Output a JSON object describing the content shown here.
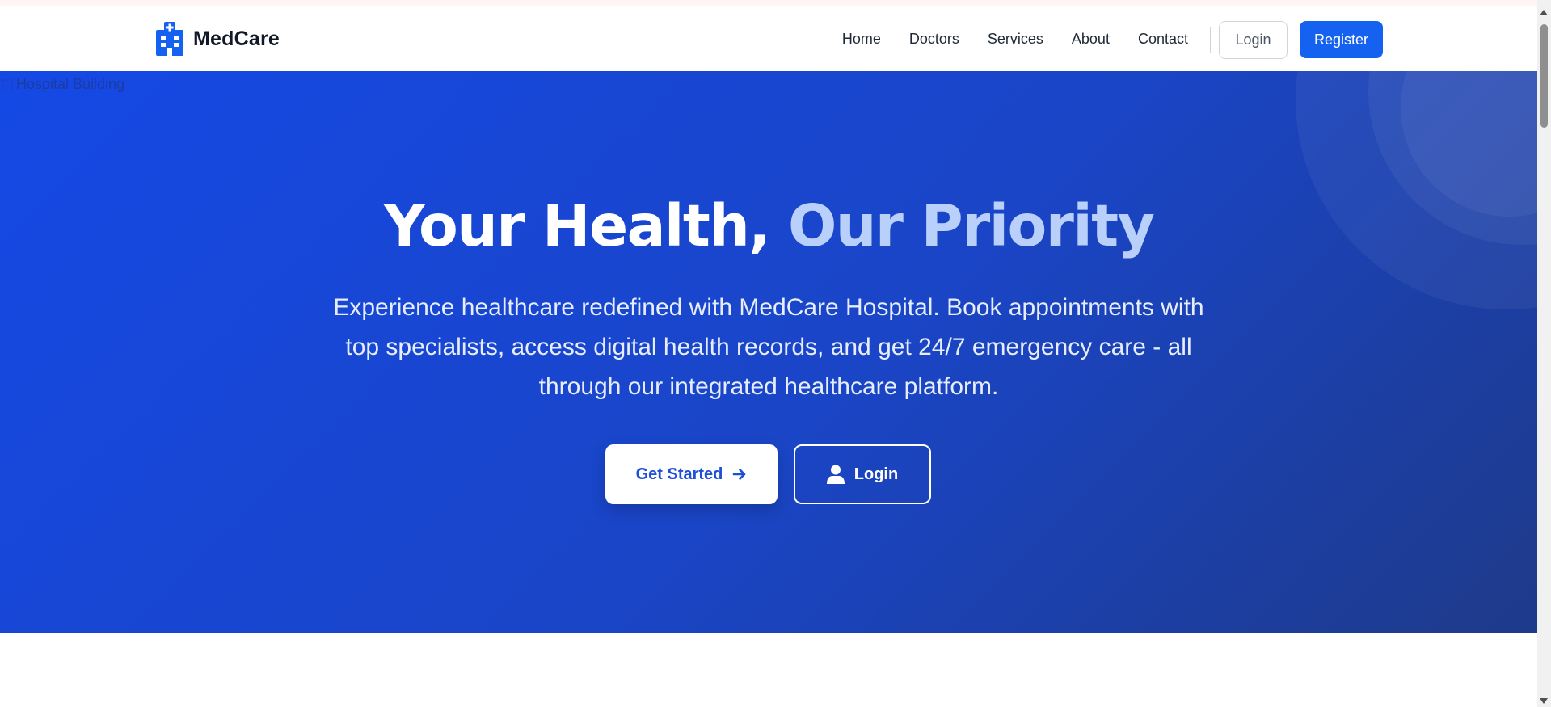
{
  "navbar": {
    "brand_name": "MedCare",
    "brand_icon": "hospital-icon",
    "links": [
      "Home",
      "Doctors",
      "Services",
      "About",
      "Contact"
    ],
    "login_label": "Login",
    "register_label": "Register"
  },
  "hero": {
    "image_alt": "Hospital Building",
    "title_main": "Your Health, ",
    "title_accent": "Our Priority",
    "description": "Experience healthcare redefined with MedCare Hospital. Book appointments with top specialists, access digital health records, and get 24/7 emergency care - all through our integrated healthcare platform.",
    "get_started_label": "Get Started",
    "get_started_icon": "arrow-right-icon",
    "login_label": "Login",
    "login_icon": "user-icon"
  },
  "colors": {
    "primary": "#1662f0",
    "hero_gradient_start": "#1549e6",
    "hero_gradient_end": "#1e3a8a",
    "title_accent": "#b9d0fb",
    "brand_text": "#111827"
  }
}
